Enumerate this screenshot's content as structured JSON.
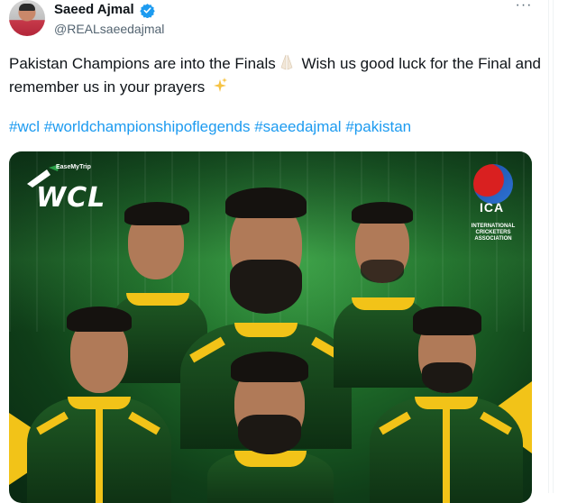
{
  "tweet": {
    "author_name": "Saeed Ajmal",
    "handle": "@REALsaeedajmal",
    "text_part1": "Pakistan Champions are into the Finals",
    "text_part2": " Wish us good luck for the Final and remember us in your prayers ",
    "hashtags": [
      "#wcl",
      "#worldchampionshipoflegends",
      "#saeedajmal",
      "#pakistan"
    ]
  },
  "icons": {
    "verified": "verified-badge-icon",
    "more": "more-options-icon",
    "praying_hands": "praying-hands-emoji",
    "sparkles": "sparkles-emoji"
  },
  "media": {
    "wcl_sponsor": "EaseMyTrip",
    "wcl_text": "WCL",
    "ica_letters": "ICA",
    "ica_caption": "INTERNATIONAL CRICKETERS ASSOCIATION"
  },
  "colors": {
    "link": "#1d9bf0",
    "text": "#0f1419",
    "muted": "#536471",
    "jersey_green": "#1f5a24",
    "jersey_yellow": "#f2c318"
  }
}
